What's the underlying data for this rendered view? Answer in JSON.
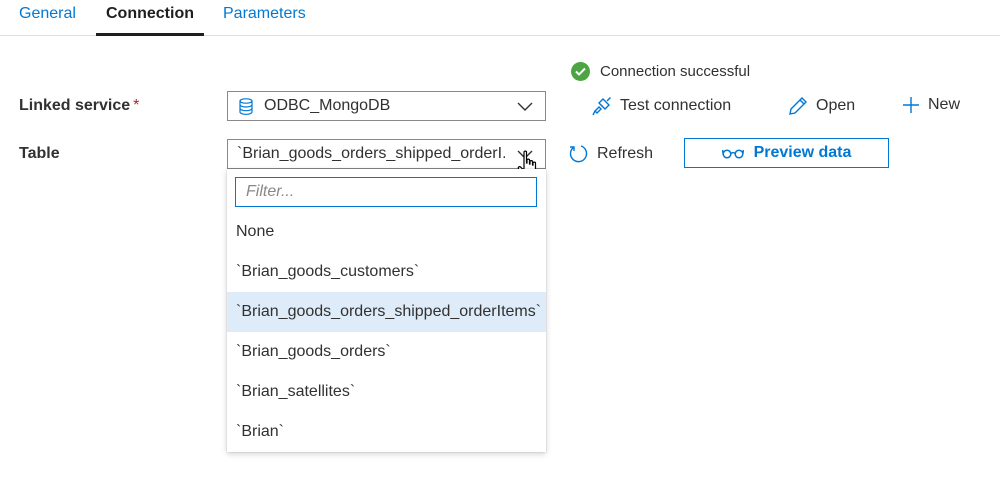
{
  "tabs": [
    {
      "label": "General",
      "active": false
    },
    {
      "label": "Connection",
      "active": true
    },
    {
      "label": "Parameters",
      "active": false
    }
  ],
  "status": {
    "text": "Connection successful",
    "color": "#4ca442"
  },
  "linked_service": {
    "label": "Linked service",
    "required_mark": "*",
    "value": "ODBC_MongoDB",
    "icon": "database-icon"
  },
  "actions": {
    "test_connection": "Test connection",
    "open": "Open",
    "new": "New",
    "refresh": "Refresh",
    "preview_data": "Preview data"
  },
  "table": {
    "label": "Table",
    "value": "`Brian_goods_orders_shipped_orderI...",
    "filter_placeholder": "Filter...",
    "options": [
      "None",
      "`Brian_goods_customers`",
      "`Brian_goods_orders_shipped_orderItems`",
      "`Brian_goods_orders`",
      "`Brian_satellites`",
      "`Brian`"
    ],
    "selected_option": "`Brian_goods_orders_shipped_orderItems`"
  },
  "colors": {
    "accent": "#0078d4",
    "selected_bg": "#deecf9",
    "required": "#a4262c"
  }
}
